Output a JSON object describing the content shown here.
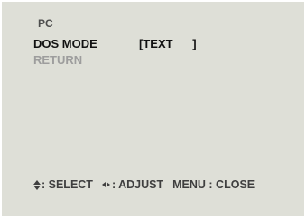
{
  "menu": {
    "title": "PC",
    "items": [
      {
        "label": "DOS MODE",
        "value": "TEXT",
        "selected": true
      },
      {
        "label": "RETURN",
        "selected": false
      }
    ]
  },
  "footer": {
    "select_label": ": SELECT",
    "adjust_label": ": ADJUST",
    "menu_close_label": "MENU : CLOSE"
  },
  "colors": {
    "background": "#dedfd7",
    "active_text": "#111111",
    "inactive_text": "#9d9d9d"
  }
}
